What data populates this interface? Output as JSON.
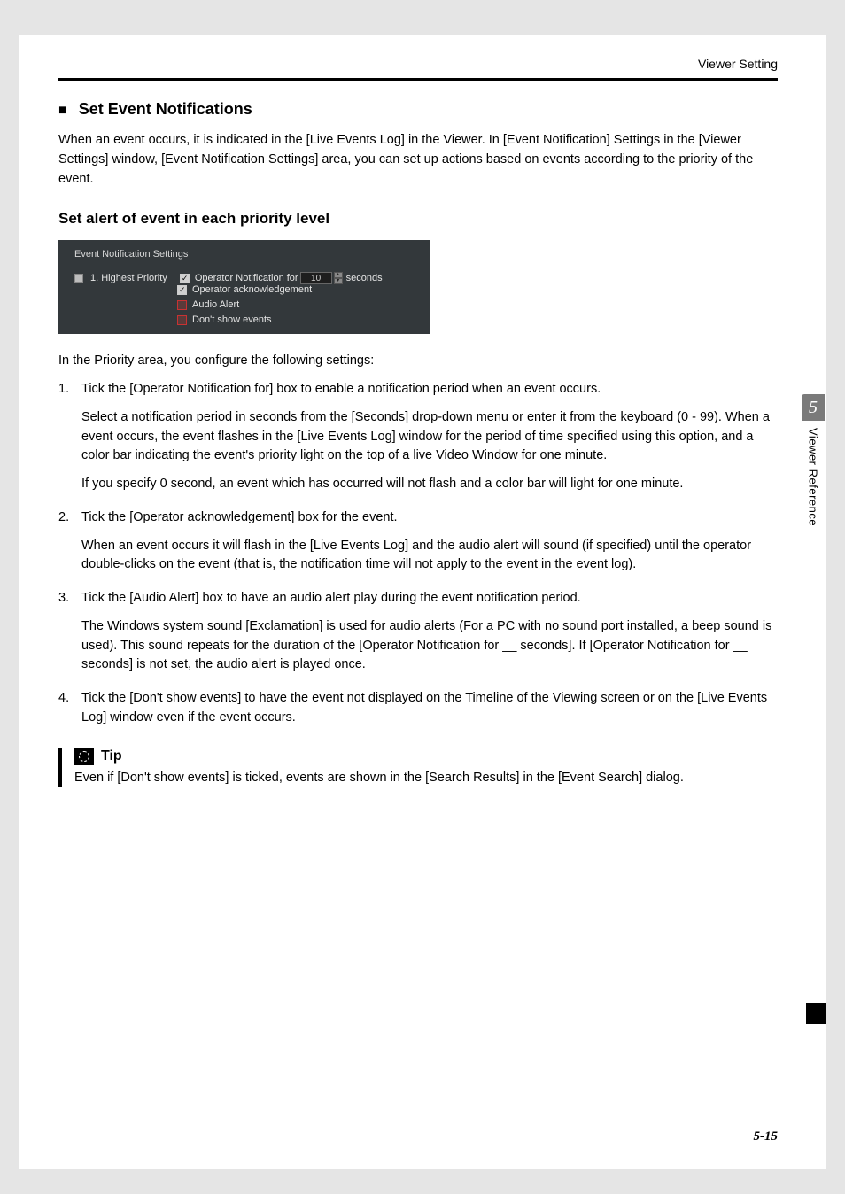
{
  "header": {
    "section": "Viewer Setting"
  },
  "title": "Set Event Notifications",
  "intro": "When an event occurs, it is indicated in the [Live Events Log] in the Viewer. In [Event Notification] Settings in the [Viewer Settings] window, [Event Notification Settings] area, you can set up actions based on events according to the priority of the event.",
  "subheading": "Set alert of event in each priority level",
  "panel": {
    "title": "Event Notification Settings",
    "priority_label": "1. Highest Priority",
    "op_notif_prefix": "Operator Notification for",
    "op_notif_value": "10",
    "op_notif_suffix": "seconds",
    "op_ack": "Operator acknowledgement",
    "audio_alert": "Audio Alert",
    "dont_show": "Don't show events"
  },
  "after_panel": "In the Priority area, you configure the following settings:",
  "steps": {
    "s1_head": "Tick the [Operator Notification for] box to enable a notification period when an event occurs.",
    "s1_p1": "Select a notification period in seconds from the [Seconds] drop-down menu or enter it from the keyboard (0 - 99). When a event occurs, the event flashes in the [Live Events Log] window for the period of time specified using this option, and a color bar indicating the event's priority light on the top of a live Video Window for one minute.",
    "s1_p2": "If you specify 0 second, an event which has occurred will not flash and a color bar will light for one minute.",
    "s2_head": "Tick the [Operator acknowledgement] box for the event.",
    "s2_p1": "When an event occurs it will flash in the [Live Events Log] and the audio alert will sound (if specified) until the operator double-clicks on the event (that is, the notification time will not apply to the event in the event log).",
    "s3_head": "Tick the [Audio Alert] box to have an audio alert play during the event notification period.",
    "s3_p1": "The Windows system sound [Exclamation] is used for audio alerts (For a PC with no sound port installed, a beep sound is used). This sound repeats for the duration of the [Operator Notification for __ seconds]. If [Operator Notification for __ seconds] is not set, the audio alert is played once.",
    "s4_head": "Tick the [Don't show events] to have the event not displayed on the Timeline of the Viewing screen or on the [Live Events Log] window even if the event occurs."
  },
  "tip": {
    "label": "Tip",
    "text": "Even if [Don't show events] is ticked, events are shown in the [Search Results] in the [Event Search] dialog."
  },
  "side": {
    "chapter_num": "5",
    "chapter_label": "Viewer Reference"
  },
  "page_number": "5-15"
}
